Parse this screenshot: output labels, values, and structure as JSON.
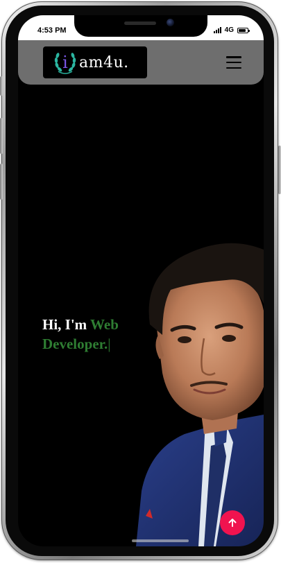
{
  "status_bar": {
    "time": "4:53 PM",
    "network": "4G",
    "battery_level": 0.85
  },
  "navbar": {
    "logo_letter": "i",
    "logo_text": "am4u.",
    "menu_icon": "hamburger-menu-icon"
  },
  "hero": {
    "greeting": "Hi, I'm",
    "role": "Web Developer.",
    "cursor": "|"
  },
  "actions": {
    "scroll_top_icon": "arrow-up-icon"
  },
  "colors": {
    "navbar_bg": "#6e6e6e",
    "screen_bg": "#000000",
    "accent_green": "#2e7d32",
    "scroll_button": "#f0134f",
    "logo_purple": "#7b57e8",
    "laurel_teal": "#2bb5a0"
  }
}
